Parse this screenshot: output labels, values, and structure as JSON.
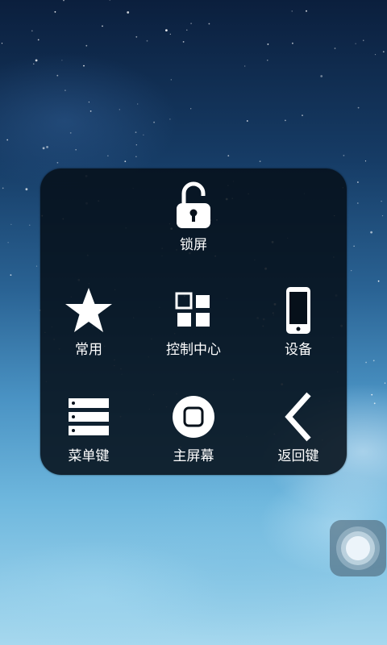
{
  "panel": {
    "items": [
      {
        "label": "锁屏",
        "icon": "unlock-icon"
      },
      {
        "label": "常用",
        "icon": "star-icon"
      },
      {
        "label": "控制中心",
        "icon": "control-center-icon"
      },
      {
        "label": "设备",
        "icon": "phone-icon"
      },
      {
        "label": "菜单键",
        "icon": "menu-list-icon"
      },
      {
        "label": "主屏幕",
        "icon": "home-button-icon"
      },
      {
        "label": "返回键",
        "icon": "back-chevron-icon"
      }
    ]
  },
  "colors": {
    "panel_bg": "#06101a",
    "label": "#ffffff",
    "icon": "#ffffff"
  }
}
